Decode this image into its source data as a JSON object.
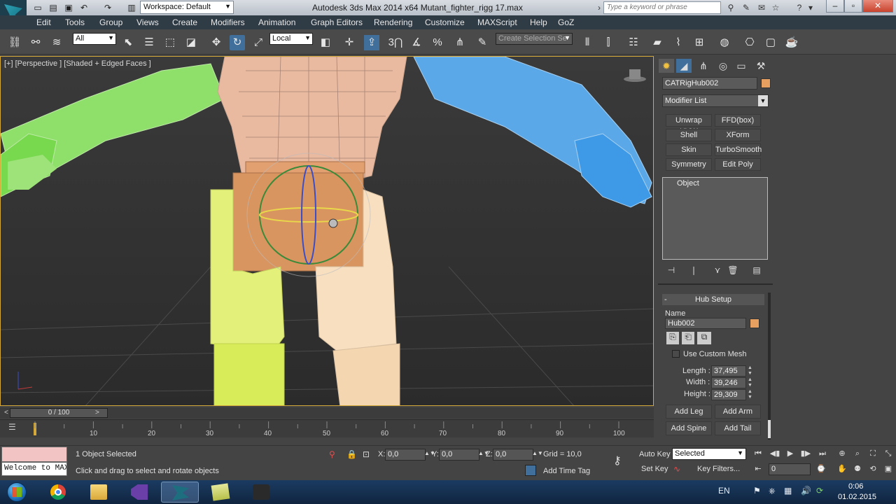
{
  "titlebar": {
    "workspace": "Workspace: Default",
    "title": "Autodesk 3ds Max  2014 x64      Mutant_fighter_rigg 17.max",
    "search_placeholder": "Type a keyword or phrase"
  },
  "menu": [
    "Edit",
    "Tools",
    "Group",
    "Views",
    "Create",
    "Modifiers",
    "Animation",
    "Graph Editors",
    "Rendering",
    "Customize",
    "MAXScript",
    "Help",
    "GoZ"
  ],
  "toolbar": {
    "filter": "All",
    "coord_system": "Local",
    "selection_set_placeholder": "Create Selection Se",
    "snap_value": "3"
  },
  "viewport": {
    "label": "[+] [Perspective ] [Shaded + Edged Faces ]"
  },
  "timeline": {
    "frame_display": "0 / 100",
    "ticks": [
      "10",
      "20",
      "30",
      "40",
      "50",
      "60",
      "70",
      "80",
      "90",
      "100"
    ]
  },
  "command_panel": {
    "object_name": "CATRigHub002",
    "object_color": "#e8a060",
    "modifier_list": "Modifier List",
    "modifier_buttons": [
      "Unwrap UVW",
      "FFD(box)",
      "Shell",
      "XForm",
      "Skin",
      "TurboSmooth",
      "Symmetry",
      "Edit Poly"
    ],
    "stack_item": "Object",
    "rollout": {
      "title": "Hub Setup",
      "name_label": "Name",
      "name_value": "Hub002",
      "use_custom_mesh": "Use Custom Mesh",
      "length_label": "Length :",
      "length_value": "37,495",
      "width_label": "Width :",
      "width_value": "39,246",
      "height_label": "Height :",
      "height_value": "29,309",
      "buttons": [
        "Add Leg",
        "Add Arm",
        "Add Spine",
        "Add Tail"
      ]
    }
  },
  "status": {
    "maxscript_text": "Welcome to MAXScript.",
    "selection": "1 Object Selected",
    "prompt": "Click and drag to select and rotate objects",
    "x_label": "X:",
    "x_value": "0,0",
    "y_label": "Y:",
    "y_value": "0,0",
    "z_label": "Z:",
    "z_value": "0,0",
    "grid": "Grid = 10,0",
    "add_time_tag": "Add Time Tag",
    "auto_key": "Auto Key",
    "set_key": "Set Key",
    "selected": "Selected",
    "key_filters": "Key Filters...",
    "frame": "0"
  },
  "taskbar": {
    "lang": "EN",
    "time": "0:06",
    "date": "01.02.2015"
  }
}
